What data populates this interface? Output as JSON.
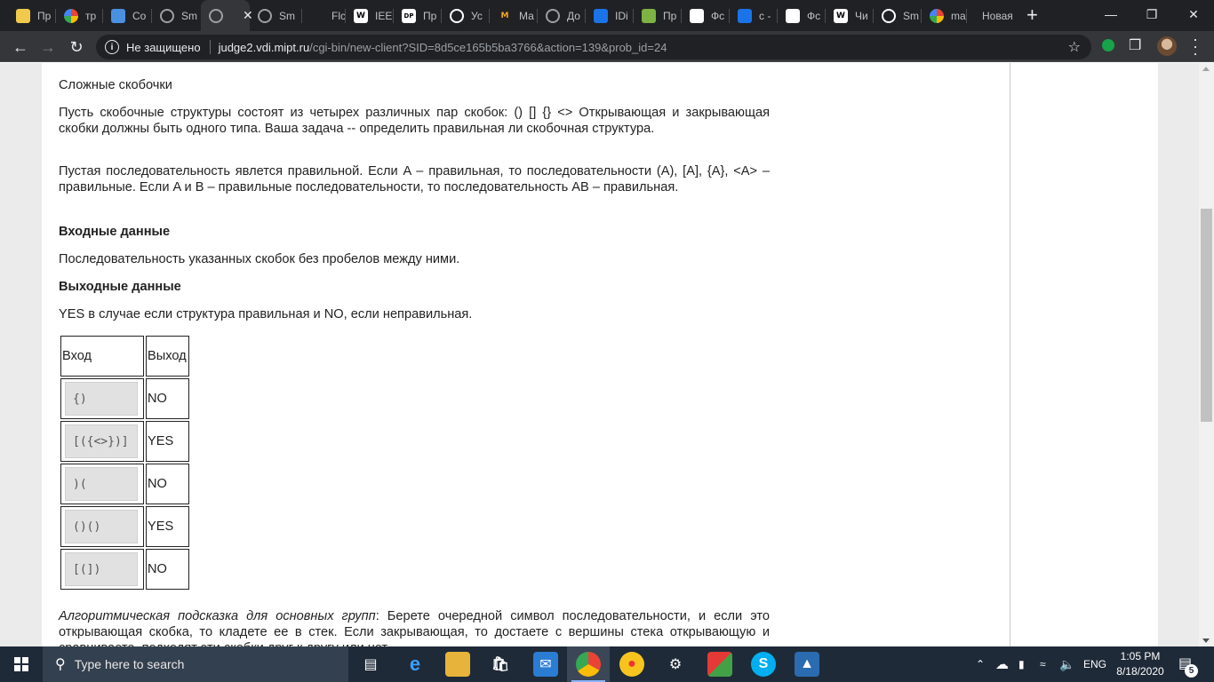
{
  "browser": {
    "tabs": [
      {
        "label": "Пр",
        "icon": "app-favicon",
        "color": "#f2c94c"
      },
      {
        "label": "тр",
        "icon": "google-icon",
        "color": "#ffffff"
      },
      {
        "label": "Co",
        "icon": "chat-icon",
        "color": "#4a90e2"
      },
      {
        "label": "Sm",
        "icon": "globe-icon",
        "color": "#9aa0a6"
      },
      {
        "label": "",
        "icon": "globe-icon",
        "color": "#9aa0a6",
        "active": true
      },
      {
        "label": "Sm",
        "icon": "globe-icon",
        "color": "#9aa0a6"
      },
      {
        "label": "Flc",
        "icon": "blank-favicon",
        "color": "#202124"
      },
      {
        "label": "IEE",
        "icon": "wikipedia-icon",
        "color": "#ffffff"
      },
      {
        "label": "Пр",
        "icon": "dp-icon",
        "color": "#ffffff"
      },
      {
        "label": "Ус",
        "icon": "globe-icon",
        "color": "#ffffff"
      },
      {
        "label": "Ма",
        "icon": "m-icon",
        "color": "#f5a623"
      },
      {
        "label": "До",
        "icon": "globe-icon",
        "color": "#9aa0a6"
      },
      {
        "label": "IDi",
        "icon": "people-icon",
        "color": "#1a73e8"
      },
      {
        "label": "Пр",
        "icon": "book-icon",
        "color": "#7cb342"
      },
      {
        "label": "Фс",
        "icon": "page-icon",
        "color": "#ffffff"
      },
      {
        "label": "c -",
        "icon": "stack-icon",
        "color": "#1a73e8"
      },
      {
        "label": "Фс",
        "icon": "page-icon",
        "color": "#ffffff"
      },
      {
        "label": "Чи",
        "icon": "wikipedia-icon",
        "color": "#ffffff"
      },
      {
        "label": "Sm",
        "icon": "globe-icon",
        "color": "#ffffff"
      },
      {
        "label": "ma",
        "icon": "google-icon",
        "color": "#ffffff"
      },
      {
        "label": "Новая",
        "icon": "none",
        "color": "#202124"
      }
    ],
    "new_tab_symbol": "+",
    "window_controls": {
      "minimize": "—",
      "restore": "❐",
      "close": "✕"
    },
    "address": {
      "security_text": "Не защищено",
      "host": "judge2.vdi.mipt.ru",
      "path": "/cgi-bin/new-client?SID=8d5ce165b5ba3766&action=139&prob_id=24"
    }
  },
  "problem": {
    "title": "Сложные скобочки",
    "p1": "Пусть скобочные структуры состоят из четырех различных пар скобок: () [] {} <> Открывающая и закрывающая скобки должны быть одного типа. Ваша задача -- определить правильная ли скобочная структура.",
    "p2": "Пустая последовательность явлется правильной. Если A – правильная, то последовательности (A), [A], {A}, <A> – правильные. Если A и B – правильные последовательности, то последовательность AB – правильная.",
    "input_heading": "Входные данные",
    "input_text": "Последовательность указанных скобок без пробелов между ними.",
    "output_heading": "Выходные данные",
    "output_text": "YES в случае если структура правильная и NO, если неправильная.",
    "table": {
      "headers": [
        "Вход",
        "Выход"
      ],
      "rows": [
        {
          "input": "{)",
          "output": "NO"
        },
        {
          "input": "[({<>})]",
          "output": "YES"
        },
        {
          "input": ")(",
          "output": "NO"
        },
        {
          "input": "()()",
          "output": "YES"
        },
        {
          "input": "[(])",
          "output": "NO"
        }
      ]
    },
    "hint_italic": "Алгоритмическая подсказка для основных групп",
    "hint_rest": ": Берете очередной символ последовательности, и если это открывающая скобка, то кладете ее в стек. Если закрывающая, то достаете с вершины стека открывающую и сравниваете, подходят эти скобки друг к другу или нет."
  },
  "taskbar": {
    "search_placeholder": "Type here to search",
    "language": "ENG",
    "time": "1:05 PM",
    "date": "8/18/2020",
    "notification_count": "5"
  }
}
